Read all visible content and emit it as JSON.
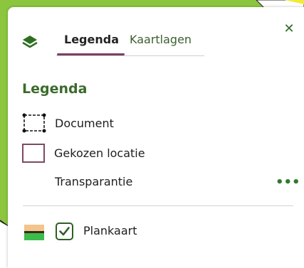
{
  "map": {
    "background_color": "#8cc63f"
  },
  "panel": {
    "close_icon": "close-icon",
    "layers_icon": "layers-icon"
  },
  "tabs": [
    {
      "label": "Legenda",
      "active": true
    },
    {
      "label": "Kaartlagen",
      "active": false
    }
  ],
  "legend": {
    "title": "Legenda",
    "items": [
      {
        "label": "Document",
        "icon": "document-outline-icon"
      },
      {
        "label": "Gekozen locatie",
        "icon": "chosen-location-icon"
      }
    ],
    "transparency_label": "Transparantie",
    "more_label": "•••"
  },
  "layer": {
    "label": "Plankaart",
    "checked": true
  }
}
